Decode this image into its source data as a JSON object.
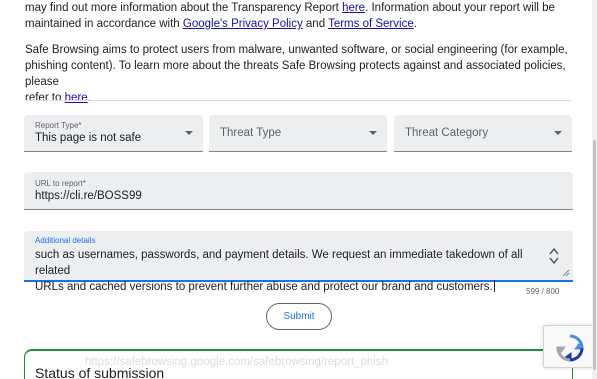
{
  "intro": {
    "line1_prefix": "may find out more information about the Transparency Report ",
    "line1_link": "here",
    "line1_suffix": ". Information about your report will be",
    "line2_prefix": "maintained in accordance with ",
    "privacy_link": "Google's Privacy Policy",
    "line2_mid": " and ",
    "terms_link": "Terms of Service",
    "line2_suffix": "."
  },
  "safe_browsing": {
    "line1": "Safe Browsing aims to protect users from malware, unwanted software, or social engineering (for example,",
    "line2": "phishing content). To learn more about the threats Safe Browsing protects against and associated policies, please",
    "line3_prefix": "refer to ",
    "line3_link": "here",
    "line3_suffix": "."
  },
  "form": {
    "report_type": {
      "label": "Report Type*",
      "value": "This page is not safe"
    },
    "threat_type": {
      "placeholder": "Threat Type"
    },
    "threat_category": {
      "placeholder": "Threat Category"
    },
    "url": {
      "label": "URL to report*",
      "value": "https://cli.re/BOSS99"
    },
    "details": {
      "label": "Additional details",
      "line1": "such as usernames, passwords, and payment details. We request an immediate takedown of all related",
      "line2": "URLs and cached versions to prevent further abuse and protect our brand and customers."
    },
    "counter": "599 / 800",
    "submit_label": "Submit"
  },
  "status": {
    "ghost_text": "https://safebrowsing.google.com/safebrowsing/report_phish",
    "heading": "Status of submission"
  },
  "colors": {
    "link": "#1a0dab",
    "accent": "#1a73e8",
    "success": "#1e8e3e",
    "field_bg": "#eceef0"
  },
  "icons": {
    "select_caret": "caret-down-icon",
    "recaptcha": "recaptcha-icon"
  }
}
